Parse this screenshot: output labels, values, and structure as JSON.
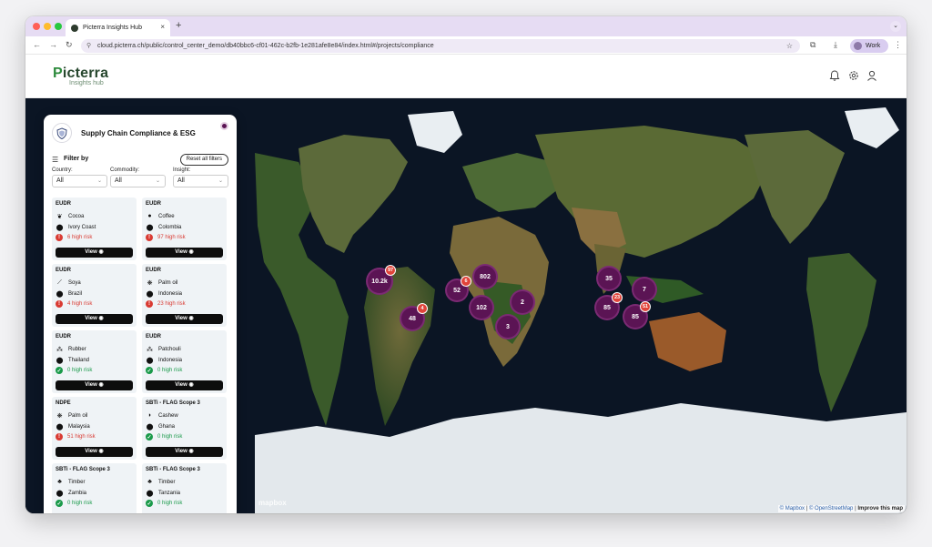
{
  "browser": {
    "tab_title": "Picterra Insights Hub",
    "tab_close": "×",
    "new_tab": "+",
    "tab_menu": "⌄",
    "url": "cloud.picterra.ch/public/control_center_demo/db40bbc6-cf01-462c-b2fb-1e281afe8e84/index.html#/projects/compliance",
    "profile_label": "Work"
  },
  "header": {
    "brand_p": "P",
    "brand_rest": "icterra",
    "brand_sub": "Insights hub"
  },
  "sidebar": {
    "title": "Supply Chain Compliance & ESG",
    "filter_label": "Filter by",
    "reset_label": "Reset all filters",
    "filters": [
      {
        "label": "Country:",
        "value": "All"
      },
      {
        "label": "Commodity:",
        "value": "All"
      },
      {
        "label": "Insight:",
        "value": "All"
      }
    ],
    "view_label": "View",
    "cards": [
      {
        "regulation": "EUDR",
        "commodity": "Cocoa",
        "country": "Ivory Coast",
        "risk": "6 high risk",
        "level": "high",
        "commodity_icon": "cocoa-icon"
      },
      {
        "regulation": "EUDR",
        "commodity": "Coffee",
        "country": "Colombia",
        "risk": "97 high risk",
        "level": "high",
        "commodity_icon": "coffee-icon"
      },
      {
        "regulation": "EUDR",
        "commodity": "Soya",
        "country": "Brazil",
        "risk": "4 high risk",
        "level": "high",
        "commodity_icon": "soya-icon"
      },
      {
        "regulation": "EUDR",
        "commodity": "Palm oil",
        "country": "Indonesia",
        "risk": "23 high risk",
        "level": "high",
        "commodity_icon": "palm-icon"
      },
      {
        "regulation": "EUDR",
        "commodity": "Rubber",
        "country": "Thailand",
        "risk": "0 high risk",
        "level": "ok",
        "commodity_icon": "rubber-icon"
      },
      {
        "regulation": "EUDR",
        "commodity": "Patchouli",
        "country": "Indonesia",
        "risk": "0 high risk",
        "level": "ok",
        "commodity_icon": "patchouli-icon"
      },
      {
        "regulation": "NDPE",
        "commodity": "Palm oil",
        "country": "Malaysia",
        "risk": "51 high risk",
        "level": "high",
        "commodity_icon": "palm-icon"
      },
      {
        "regulation": "SBTi - FLAG Scope 3",
        "commodity": "Cashew",
        "country": "Ghana",
        "risk": "0 high risk",
        "level": "ok",
        "commodity_icon": "cashew-icon"
      },
      {
        "regulation": "SBTi - FLAG Scope 3",
        "commodity": "Timber",
        "country": "Zambia",
        "risk": "0 high risk",
        "level": "ok",
        "commodity_icon": "timber-icon"
      },
      {
        "regulation": "SBTi - FLAG Scope 3",
        "commodity": "Timber",
        "country": "Tanzania",
        "risk": "0 high risk",
        "level": "ok",
        "commodity_icon": "timber-icon"
      }
    ]
  },
  "map": {
    "clusters": [
      {
        "label": "10.2k",
        "badge": "97"
      },
      {
        "label": "48",
        "badge": "4"
      },
      {
        "label": "52",
        "badge": "6"
      },
      {
        "label": "802",
        "badge": ""
      },
      {
        "label": "102",
        "badge": ""
      },
      {
        "label": "2",
        "badge": ""
      },
      {
        "label": "3",
        "badge": ""
      },
      {
        "label": "35",
        "badge": ""
      },
      {
        "label": "7",
        "badge": ""
      },
      {
        "label": "85",
        "badge": "23"
      },
      {
        "label": "85",
        "badge": "51"
      }
    ],
    "logo_text": "mapbox",
    "attribution": {
      "mapbox": "© Mapbox",
      "osm": "© OpenStreetMap",
      "improve": "Improve this map"
    }
  },
  "colors": {
    "cluster": "#5b1454",
    "badge": "#e0443a",
    "high_risk": "#d93a32",
    "ok_risk": "#1a9a4a",
    "brand": "#2d8a3c"
  }
}
